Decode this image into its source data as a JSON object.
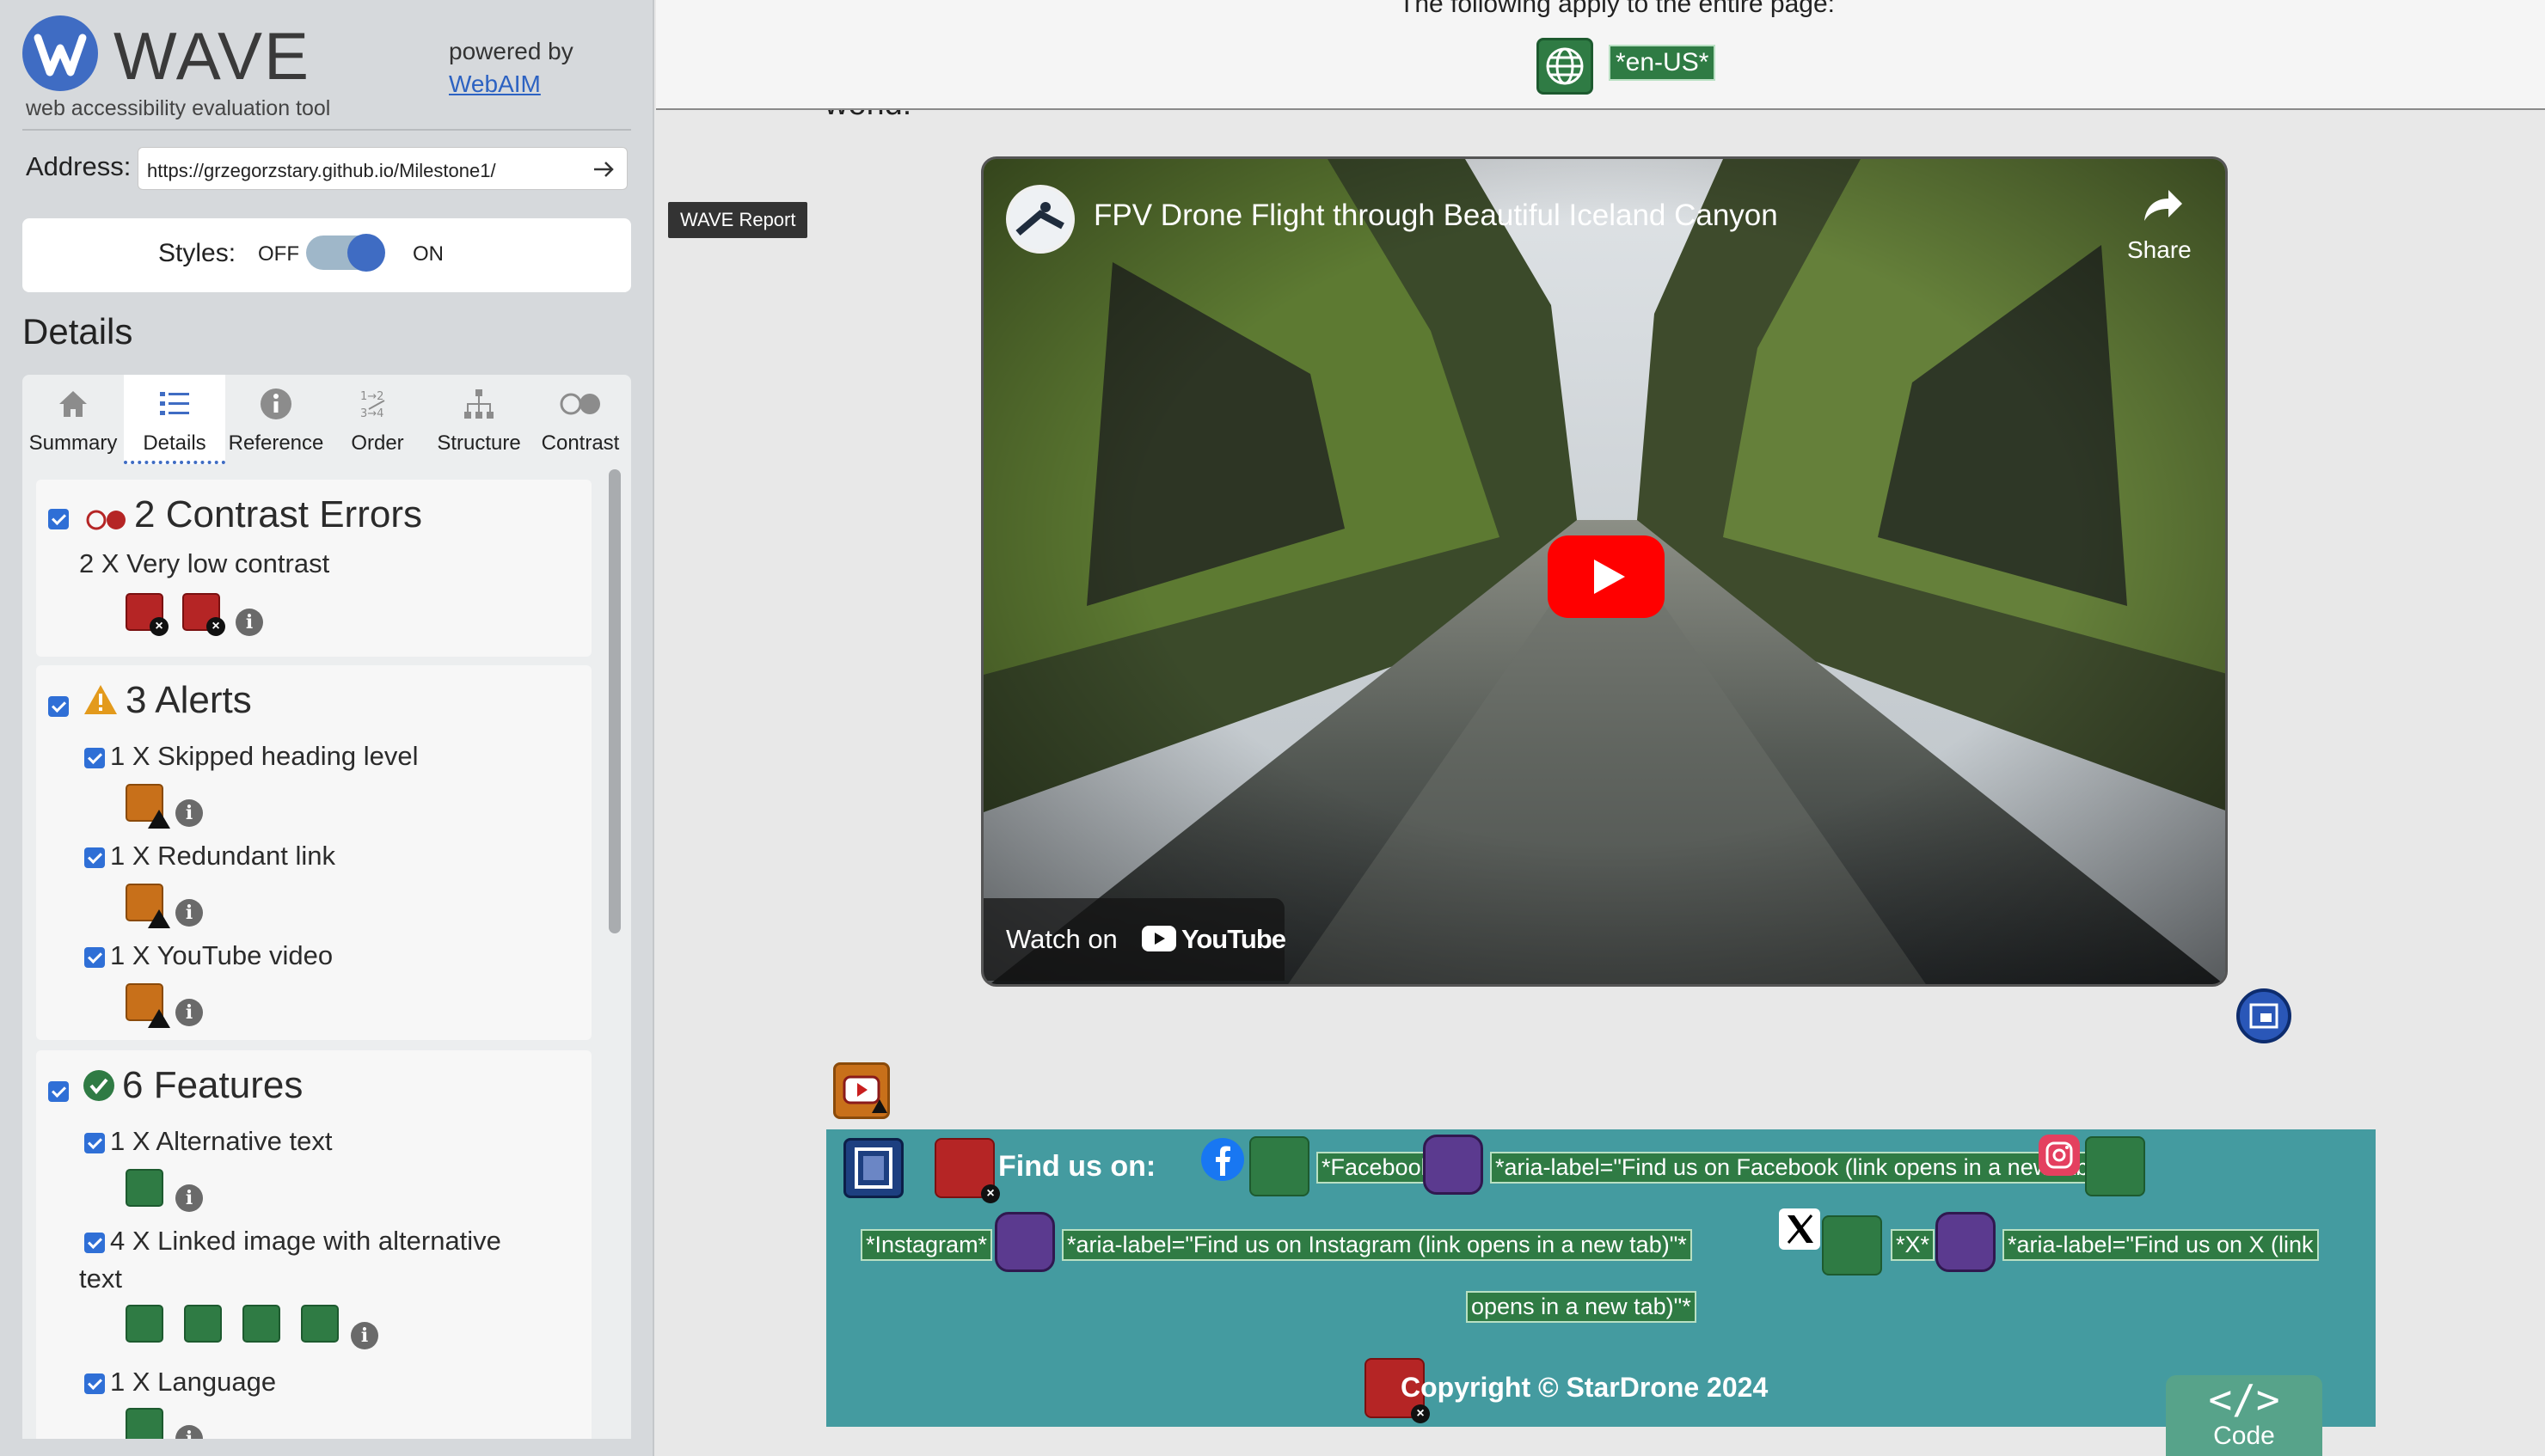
{
  "sidebar": {
    "app_name": "WAVE",
    "tagline": "web accessibility evaluation tool",
    "powered_by": "powered by",
    "webaim_link": "WebAIM",
    "address_label": "Address:",
    "address_value": "https://grzegorzstary.github.io/Milestone1/",
    "styles_label": "Styles:",
    "styles_off": "OFF",
    "styles_on": "ON",
    "styles_state": "on",
    "details_heading": "Details",
    "tabs": [
      {
        "label": "Summary",
        "icon": "home-icon"
      },
      {
        "label": "Details",
        "icon": "list-icon",
        "active": true
      },
      {
        "label": "Reference",
        "icon": "info-icon"
      },
      {
        "label": "Order",
        "icon": "order-icon"
      },
      {
        "label": "Structure",
        "icon": "structure-icon"
      },
      {
        "label": "Contrast",
        "icon": "contrast-icon"
      }
    ]
  },
  "details": {
    "contrast": {
      "title": "2 Contrast Errors",
      "items": [
        {
          "text": "2 X Very low contrast"
        }
      ]
    },
    "alerts": {
      "title": "3 Alerts",
      "items": [
        {
          "text": "1 X Skipped heading level"
        },
        {
          "text": "1 X Redundant link"
        },
        {
          "text": "1 X YouTube video"
        }
      ]
    },
    "features": {
      "title": "6 Features",
      "items": [
        {
          "text": "1 X Alternative text"
        },
        {
          "text": "4 X Linked image with alternative",
          "text2": "text"
        },
        {
          "text": "1 X Language"
        }
      ]
    }
  },
  "page": {
    "apply_text": "The following apply to the entire page:",
    "lang_tag": "*en-US*",
    "world_text": "world!",
    "wave_report_tooltip": "WAVE Report",
    "video": {
      "title": "FPV Drone Flight through Beautiful Iceland Canyon",
      "share_label": "Share",
      "watch_on": "Watch on",
      "youtube_word": "YouTube"
    },
    "footer": {
      "find_us": "Find us on:",
      "facebook_alt": "*Facebook*",
      "facebook_aria": "*aria-label=\"Find us on Facebook (link opens in a new tab)\"*",
      "instagram_alt": "*Instagram*",
      "instagram_aria": "*aria-label=\"Find us on Instagram (link opens in a new tab)\"*",
      "x_alt": "*X*",
      "x_aria_line1": "*aria-label=\"Find us on X (link",
      "x_aria_line2": "opens in a new tab)\"*",
      "copyright": "Copyright © StarDrone 2024"
    },
    "code_button": {
      "symbol": "</>",
      "label": "Code"
    }
  },
  "colors": {
    "wave_blue": "#3f6cc3",
    "error_red": "#b52525",
    "alert_orange": "#c8701a",
    "feature_green": "#2f7b44",
    "aria_purple": "#5b3a8f",
    "footer_teal": "#449ba0",
    "sidebar_bg": "#d6d9dc"
  }
}
